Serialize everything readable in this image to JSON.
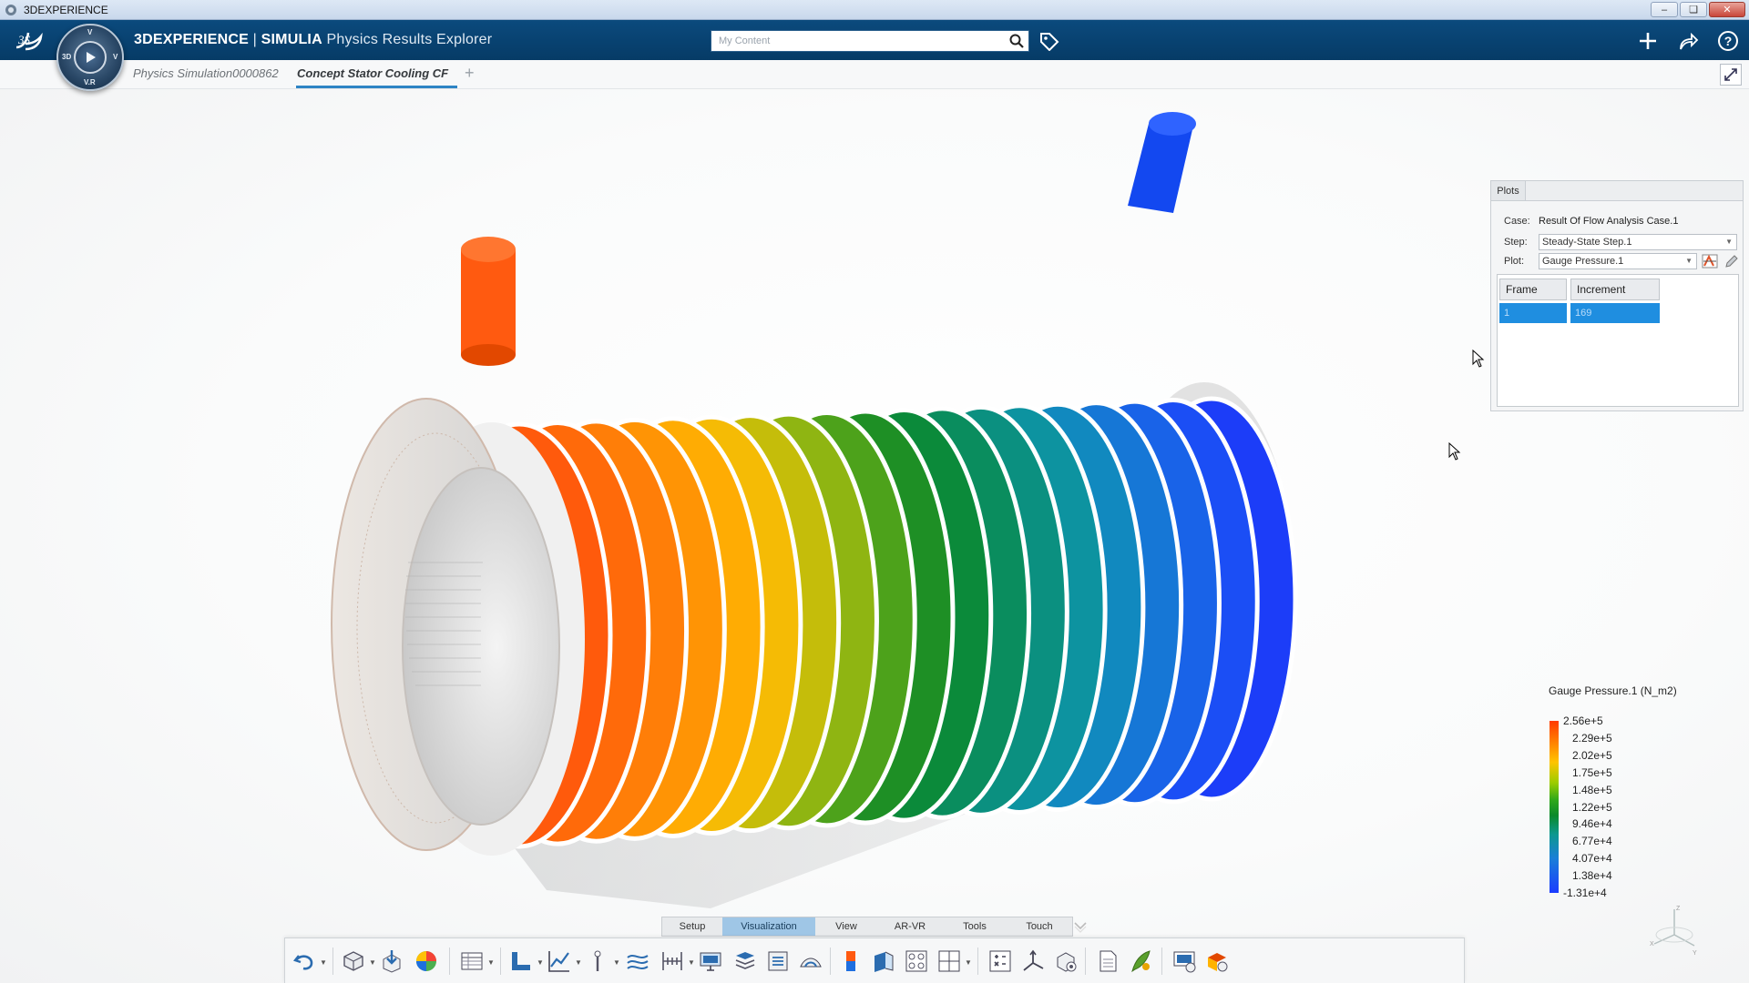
{
  "window": {
    "title": "3DEXPERIENCE"
  },
  "header": {
    "brand_part1": "3DEXPERIENCE",
    "brand_sep": " | ",
    "brand_part2": "SIMULIA",
    "brand_part3": " Physics Results Explorer",
    "search_placeholder": "My Content"
  },
  "compass": {
    "top": "V",
    "left": "3D",
    "right": "V",
    "bottom": "V.R"
  },
  "tabs": [
    {
      "label": "Physics Simulation0000862"
    },
    {
      "label": "Concept Stator Cooling CF"
    }
  ],
  "plots_panel": {
    "tab_label": "Plots",
    "case_label": "Case:",
    "case_value": "Result Of Flow Analysis Case.1",
    "step_label": "Step:",
    "step_value": "Steady-State Step.1",
    "plot_label": "Plot:",
    "plot_value": "Gauge Pressure.1",
    "table_headers": [
      "Frame",
      "Increment"
    ],
    "table_rows": [
      [
        "1",
        "169"
      ]
    ]
  },
  "legend": {
    "title": "Gauge Pressure.1 (N_m2)",
    "labels": [
      "2.56e+5",
      "2.29e+5",
      "2.02e+5",
      "1.75e+5",
      "1.48e+5",
      "1.22e+5",
      "9.46e+4",
      "6.77e+4",
      "4.07e+4",
      "1.38e+4",
      "-1.31e+4"
    ],
    "colors": [
      "#ff3a00",
      "#ff8a00",
      "#ffc400",
      "#9ccc00",
      "#2fa81a",
      "#0a8a2a",
      "#0d9890",
      "#1a7fd8",
      "#1b3cff"
    ]
  },
  "action_bar": {
    "tabs": [
      "Setup",
      "Visualization",
      "View",
      "AR-VR",
      "Tools",
      "Touch"
    ],
    "active_tab": "Visualization"
  },
  "model": {
    "band_colors": [
      "#ff5a0c",
      "#ff6a0a",
      "#ff7e08",
      "#ff9405",
      "#ffac03",
      "#f5bb05",
      "#c5bd0a",
      "#8fb512",
      "#4da21b",
      "#1e8f25",
      "#0b8a3a",
      "#0a8d5e",
      "#0b9080",
      "#0d93a0",
      "#1189bf",
      "#1677d6",
      "#1963e8",
      "#1b4ef5",
      "#1c3df8"
    ],
    "inlet_color": "#ff5a10",
    "outlet_color": "#1348f0"
  }
}
